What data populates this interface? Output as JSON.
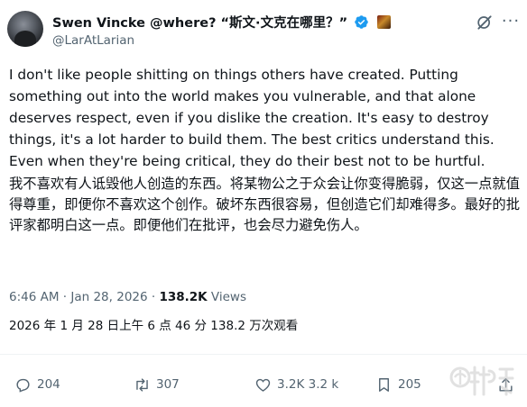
{
  "author": {
    "display_name": "Swen Vincke @where? “斯文·文克在哪里？”",
    "handle": "@LarAtLarian"
  },
  "post": {
    "body_en": "I don't like people shitting on things others have created. Putting something out into the world makes you vulnerable, and that alone deserves respect, even if you dislike the creation. It's easy to destroy things, it's a lot harder to build them. The best critics understand this. Even when they're being critical, they do their best not to be hurtful.",
    "body_zh": "我不喜欢有人诋毁他人创造的东西。将某物公之于众会让你变得脆弱，仅这一点就值得尊重，即便你不喜欢这个创作。破坏东西很容易，但创造它们却难得多。最好的批评家都明白这一点。即便他们在批评，也会尽力避免伤人。",
    "timestamp": "6:46 AM · Jan 28, 2026 · ",
    "views_count": "138.2K",
    "views_label": " Views",
    "timestamp_zh": "2026 年 1 月 28 日上午 6 点 46 分 138.2 万次观看"
  },
  "actions": {
    "replies": "204",
    "reposts": "307",
    "likes": "3.2K 3.2 k",
    "bookmarks": "205"
  },
  "icons": {
    "verified": "verified-badge-icon",
    "grok": "grok-icon",
    "more": "more-icon",
    "reply": "reply-icon",
    "repost": "repost-icon",
    "like": "heart-icon",
    "bookmark": "bookmark-icon",
    "share": "share-icon"
  },
  "colors": {
    "text": "#0f1419",
    "secondary": "#536471",
    "verified": "#1d9bf0"
  }
}
